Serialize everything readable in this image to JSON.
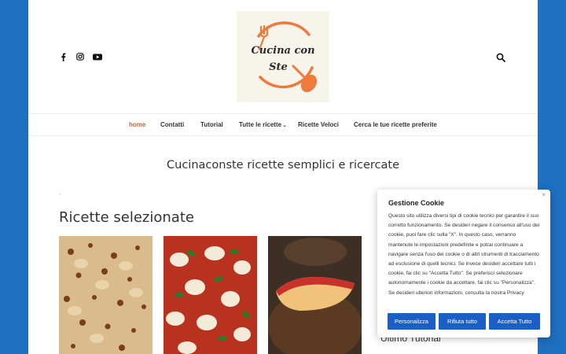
{
  "header": {
    "social_icons": [
      "facebook-icon",
      "instagram-icon",
      "youtube-icon"
    ],
    "logo": {
      "line1": "Cucina con",
      "line2": "Ste"
    }
  },
  "nav": {
    "items": [
      {
        "label": "home",
        "active": true
      },
      {
        "label": "Contatti"
      },
      {
        "label": "Tutorial"
      },
      {
        "label": "Tutte le ricette",
        "dropdown": true
      },
      {
        "label": "Ricette Veloci"
      },
      {
        "label": "Cerca le tue ricette preferite"
      }
    ],
    "caret": "⌄"
  },
  "main": {
    "tagline": "Cucinaconste ricette semplici e ricercate",
    "dash": "-",
    "section_title": "Ricette selezionate",
    "sidebar_heading": "Ultimo Tutorial"
  },
  "cookie": {
    "title": "Gestione Cookie",
    "close": "×",
    "text": "Questo sito utilizza diversi tipi di cookie tecnici per garantire il suo corretto funzionamento. Se desideri negare il consenso all'uso dei cookie, puoi fare clic sulla \"X\". In questo caso, verranno mantenute le impostazioni predefinite e potrai continuare a navigare senza l'uso dei cookie o di altri strumenti di tracciamento ad esclusione di quelli tecnici. Se invece desideri accettare tutti i cookie, fai clic su \"Accetta Tutto\". Se preferisci selezionare autonomamente i cookie da accettare, fai clic su \"Personalizza\". Se desideri ulteriori informazioni, consulta la nostra Privacy",
    "buttons": {
      "customize": "Personalizza",
      "reject": "Rifiuta tutto",
      "accept": "Accetta Tutto"
    }
  },
  "colors": {
    "background": "#1f6fc0",
    "accent": "#c0643c",
    "button": "#1b5fc6"
  }
}
